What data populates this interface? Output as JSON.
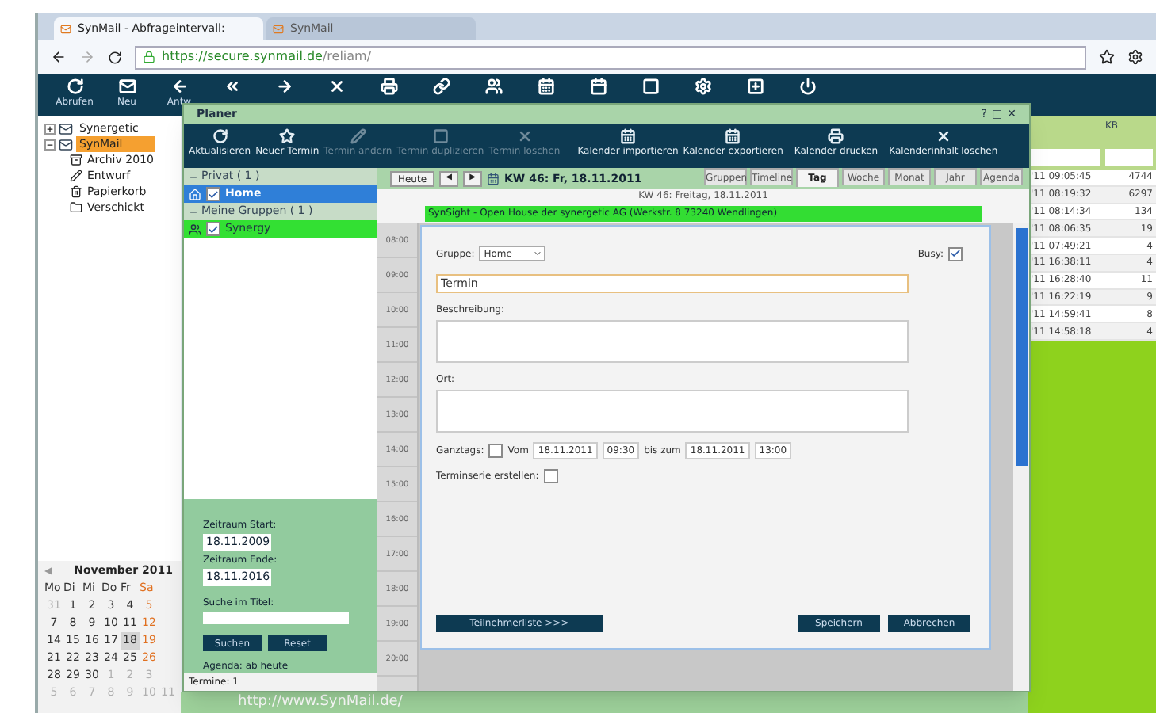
{
  "browser": {
    "tabs": [
      {
        "label": "SynMail - Abfrageintervall:",
        "selected": true
      },
      {
        "label": "SynMail",
        "selected": false
      }
    ],
    "url_host": "https://secure.synmail.de",
    "url_path": "/reliam/"
  },
  "mail_toolbar": {
    "labels": [
      "Abrufen",
      "Neu",
      "Antw"
    ]
  },
  "folders": [
    {
      "label": "Synergetic",
      "selected": false,
      "expanded": false
    },
    {
      "label": "SynMail",
      "selected": true,
      "expanded": true,
      "children": [
        {
          "label": "Archiv 2010",
          "selected": false
        },
        {
          "label": "Entwurf",
          "selected": false
        },
        {
          "label": "Papierkorb",
          "selected": false
        },
        {
          "label": "Verschickt",
          "selected": false
        }
      ]
    }
  ],
  "mini_calendar": {
    "prev": "◀",
    "month": "November 2011",
    "weekdays": [
      {
        "label": "Mo",
        "kind": "day"
      },
      {
        "label": "Di",
        "kind": "day"
      },
      {
        "label": "Mi",
        "kind": "day"
      },
      {
        "label": "Do",
        "kind": "day"
      },
      {
        "label": "Fr",
        "kind": "day"
      },
      {
        "label": "Sa",
        "kind": "weekend"
      }
    ],
    "weeks": [
      [
        {
          "d": "31",
          "kind": "other",
          "selected": false
        },
        {
          "d": "1",
          "kind": "day",
          "selected": false
        },
        {
          "d": "2",
          "kind": "day",
          "selected": false
        },
        {
          "d": "3",
          "kind": "day",
          "selected": false
        },
        {
          "d": "4",
          "kind": "day",
          "selected": false
        },
        {
          "d": "5",
          "kind": "weekend",
          "selected": false
        }
      ],
      [
        {
          "d": "7",
          "kind": "day",
          "selected": false
        },
        {
          "d": "8",
          "kind": "day",
          "selected": false
        },
        {
          "d": "9",
          "kind": "day",
          "selected": false
        },
        {
          "d": "10",
          "kind": "day",
          "selected": false
        },
        {
          "d": "11",
          "kind": "day",
          "selected": false
        },
        {
          "d": "12",
          "kind": "weekend",
          "selected": false
        }
      ],
      [
        {
          "d": "14",
          "kind": "day",
          "selected": false
        },
        {
          "d": "15",
          "kind": "day",
          "selected": false
        },
        {
          "d": "16",
          "kind": "day",
          "selected": false
        },
        {
          "d": "17",
          "kind": "day",
          "selected": false
        },
        {
          "d": "18",
          "kind": "day",
          "selected": true
        },
        {
          "d": "19",
          "kind": "weekend",
          "selected": false
        }
      ],
      [
        {
          "d": "21",
          "kind": "day",
          "selected": false
        },
        {
          "d": "22",
          "kind": "day",
          "selected": false
        },
        {
          "d": "23",
          "kind": "day",
          "selected": false
        },
        {
          "d": "24",
          "kind": "day",
          "selected": false
        },
        {
          "d": "25",
          "kind": "day",
          "selected": false
        },
        {
          "d": "26",
          "kind": "weekend",
          "selected": false
        }
      ],
      [
        {
          "d": "28",
          "kind": "day",
          "selected": false
        },
        {
          "d": "29",
          "kind": "day",
          "selected": false
        },
        {
          "d": "30",
          "kind": "day",
          "selected": false
        },
        {
          "d": "1",
          "kind": "other",
          "selected": false
        },
        {
          "d": "2",
          "kind": "other",
          "selected": false
        },
        {
          "d": "3",
          "kind": "other",
          "selected": false
        }
      ],
      [
        {
          "d": "5",
          "kind": "other",
          "selected": false
        },
        {
          "d": "6",
          "kind": "other",
          "selected": false
        },
        {
          "d": "7",
          "kind": "other",
          "selected": false
        },
        {
          "d": "8",
          "kind": "other",
          "selected": false
        },
        {
          "d": "9",
          "kind": "other",
          "selected": false
        },
        {
          "d": "10",
          "kind": "other",
          "selected": false
        },
        {
          "d": "11",
          "kind": "other",
          "selected": false
        }
      ]
    ]
  },
  "mail_list": {
    "column": "KB",
    "rows": [
      {
        "time": "'11 09:05:45",
        "kb": "4744"
      },
      {
        "time": "'11 08:19:32",
        "kb": "6297"
      },
      {
        "time": "'11 08:14:34",
        "kb": "134"
      },
      {
        "time": "'11 08:06:35",
        "kb": "19"
      },
      {
        "time": "'11 07:49:21",
        "kb": "4"
      },
      {
        "time": "'11 16:38:11",
        "kb": "4"
      },
      {
        "time": "'11 16:28:40",
        "kb": "11"
      },
      {
        "time": "'11 16:22:19",
        "kb": "9"
      },
      {
        "time": "'11 14:59:41",
        "kb": "8"
      },
      {
        "time": "'11 14:58:18",
        "kb": "4"
      }
    ]
  },
  "footer_link": "http://www.SynMail.de/",
  "planer": {
    "title": "Planer",
    "window_buttons": [
      "?",
      "□",
      "✕"
    ],
    "toolbar": [
      {
        "label": "Aktualisieren",
        "disabled": false
      },
      {
        "label": "Neuer Termin",
        "disabled": false
      },
      {
        "label": "Termin ändern",
        "disabled": true
      },
      {
        "label": "Termin duplizieren",
        "disabled": true
      },
      {
        "label": "Termin löschen",
        "disabled": true
      },
      {
        "label": "Kalender importieren",
        "disabled": false
      },
      {
        "label": "Kalender exportieren",
        "disabled": false
      },
      {
        "label": "Kalender drucken",
        "disabled": false
      },
      {
        "label": "Kalenderinhalt löschen",
        "disabled": false
      }
    ],
    "groups": [
      {
        "header": "Privat ( 1 )",
        "items": [
          {
            "label": "Home",
            "checked": true,
            "kind": "home"
          }
        ]
      },
      {
        "header": "Meine Gruppen ( 1 )",
        "items": [
          {
            "label": "Synergy",
            "checked": true,
            "kind": "group"
          }
        ]
      }
    ],
    "search": {
      "start_label": "Zeitraum Start:",
      "start": "18.11.2009",
      "end_label": "Zeitraum Ende:",
      "end": "18.11.2016",
      "title_label": "Suche im Titel:",
      "buttons": [
        "Suchen",
        "Reset"
      ],
      "agenda": "Agenda: ab heute"
    },
    "count": "Termine: 1",
    "nav": {
      "today": "Heute",
      "prev": "◀",
      "next": "▶",
      "title": "KW 46: Fr, 18.11.2011"
    },
    "views": [
      {
        "label": "Gruppen",
        "selected": false
      },
      {
        "label": "Timeline",
        "selected": false
      },
      {
        "label": "Tag",
        "selected": true
      },
      {
        "label": "Woche",
        "selected": false
      },
      {
        "label": "Monat",
        "selected": false
      },
      {
        "label": "Jahr",
        "selected": false
      },
      {
        "label": "Agenda",
        "selected": false
      }
    ],
    "day_title": "KW 46: Freitag, 18.11.2011",
    "event": "SynSight - Open House der synergetic AG (Werkstr. 8 73240 Wendlingen)",
    "hours": [
      "08:00",
      "09:00",
      "10:00",
      "11:00",
      "12:00",
      "13:00",
      "14:00",
      "15:00",
      "16:00",
      "17:00",
      "18:00",
      "19:00",
      "20:00"
    ]
  },
  "dialog": {
    "group_label": "Gruppe:",
    "group": "Home",
    "busy_label": "Busy:",
    "busy": true,
    "title": "Termin",
    "description_label": "Beschreibung:",
    "location_label": "Ort:",
    "allday_label": "Ganztags:",
    "allday": false,
    "from_label": "Vom",
    "from_date": "18.11.2011",
    "from_time": "09:30",
    "to_label": "bis zum",
    "to_date": "18.11.2011",
    "to_time": "13:00",
    "series_label": "Terminserie erstellen:",
    "series": false,
    "participants": "Teilnehmerliste >>>",
    "save": "Speichern",
    "cancel": "Abbrechen"
  }
}
